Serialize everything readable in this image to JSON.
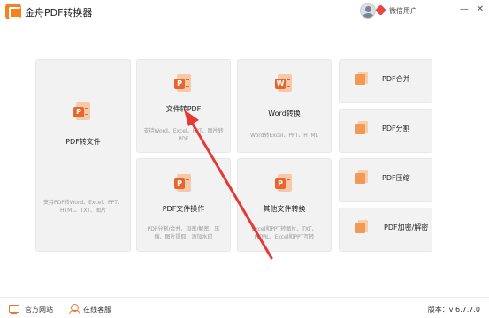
{
  "app": {
    "title": "金舟PDF转换器",
    "user_name": "微信用户",
    "minimize": "—",
    "close": "✕"
  },
  "cards": {
    "pdf_to_file": {
      "title": "PDF转文件",
      "desc": "支持PDF转Word、Excel、PPT、HTML、TXT、图片"
    },
    "file_to_pdf": {
      "title": "文件转PDF",
      "desc": "支持Word、Excel、PPT、图片转PDF"
    },
    "word_convert": {
      "title": "Word转换",
      "desc": "Word转Excel、PPT、HTML"
    },
    "pdf_ops": {
      "title": "PDF文件操作",
      "desc": "PDF分割/合并、加密/解密、压缩、图片提取、添加水印"
    },
    "other_convert": {
      "title": "其他文件转换",
      "desc": "Excel和PPT转图片、TXT、HTML、Excel和PPT互转"
    }
  },
  "small_cards": [
    {
      "title": "PDF合并",
      "icon": "pdf-merge-icon"
    },
    {
      "title": "PDF分割",
      "icon": "pdf-split-icon"
    },
    {
      "title": "PDF压缩",
      "icon": "pdf-compress-icon"
    },
    {
      "title": "PDF加密/解密",
      "icon": "pdf-encrypt-icon"
    }
  ],
  "footer": {
    "website": "官方网站",
    "support": "在线客服",
    "version": "版本：v 6.7.7.0"
  },
  "colors": {
    "accent": "#e8652d",
    "annotation_arrow": "#e53935",
    "card_bg": "#f2f2f2"
  }
}
